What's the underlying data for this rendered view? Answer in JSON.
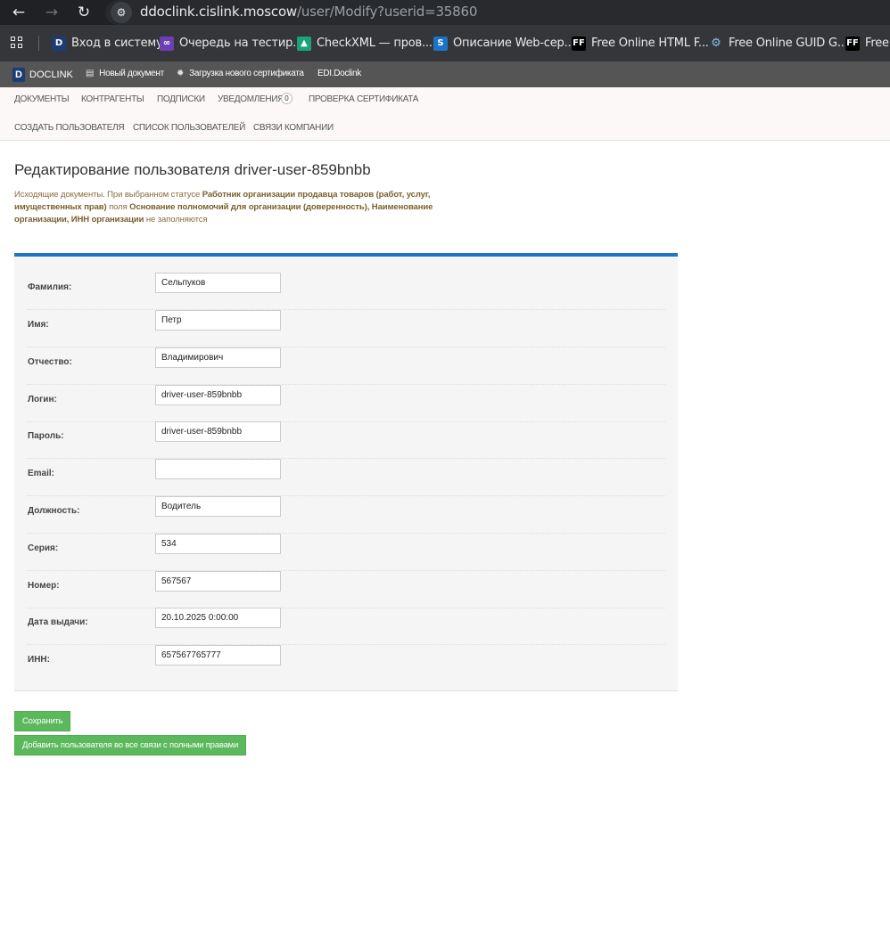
{
  "browser": {
    "url_host": "ddoclink.cislink.moscow",
    "url_path": "/user/Modify?userid=35860",
    "bookmarks": [
      {
        "label": "Вход в систему",
        "icon": "D"
      },
      {
        "label": "Очередь на тестир...",
        "icon": "vs"
      },
      {
        "label": "CheckXML — пров...",
        "icon": "xml"
      },
      {
        "label": "Описание Web-сер...",
        "icon": "S"
      },
      {
        "label": "Free Online HTML F...",
        "icon": "FF"
      },
      {
        "label": "Free Online GUID G...",
        "icon": "gear"
      },
      {
        "label": "Free",
        "icon": "FF"
      }
    ]
  },
  "app": {
    "brand": "DOCLINK",
    "brand_icon": "D",
    "links": {
      "new_doc": "Новый документ",
      "upload_cert": "Загрузка нового сертификата",
      "edi": "EDI.Doclink"
    }
  },
  "menu": {
    "row1": [
      "ДОКУМЕНТЫ",
      "КОНТРАГЕНТЫ",
      "ПОДПИСКИ",
      "УВЕДОМЛЕНИЯ",
      "ПРОВЕРКА СЕРТИФИКАТА"
    ],
    "notifications_count": "0",
    "row2": [
      "СОЗДАТЬ ПОЛЬЗОВАТЕЛЯ",
      "СПИСОК ПОЛЬЗОВАТЕЛЕЙ",
      "СВЯЗИ КОМПАНИИ"
    ]
  },
  "page": {
    "title": "Редактирование пользователя driver-user-859bnbb",
    "notice": {
      "t1": "Исходящие документы. При выбранном статусе ",
      "b1": "Работник организации продавца товаров (работ, услуг, имущественных прав)",
      "t2": " поля ",
      "b2": "Основание полномочий для организации (доверенность), Наименование организации, ИНН организации",
      "t3": " не заполняются"
    }
  },
  "form": {
    "fields": [
      {
        "label": "Фамилия:",
        "value": "Сельпуков"
      },
      {
        "label": "Имя:",
        "value": "Петр"
      },
      {
        "label": "Отчество:",
        "value": "Владимирович"
      },
      {
        "label": "Логин:",
        "value": "driver-user-859bnbb"
      },
      {
        "label": "Пароль:",
        "value": "driver-user-859bnbb"
      },
      {
        "label": "Email:",
        "value": ""
      },
      {
        "label": "Должность:",
        "value": "Водитель"
      },
      {
        "label": "Серия:",
        "value": "534"
      },
      {
        "label": "Номер:",
        "value": "567567"
      },
      {
        "label": "Дата выдачи:",
        "value": "20.10.2025 0:00:00"
      },
      {
        "label": "ИНН:",
        "value": "657567765777"
      }
    ]
  },
  "buttons": {
    "save": "Сохранить",
    "add_to_links": "Добавить пользователя во все связи с полными правами"
  },
  "colors": {
    "accent_blue": "#1e76c2",
    "button_green": "#5cb85c",
    "notice_text": "#8a6d3b"
  }
}
